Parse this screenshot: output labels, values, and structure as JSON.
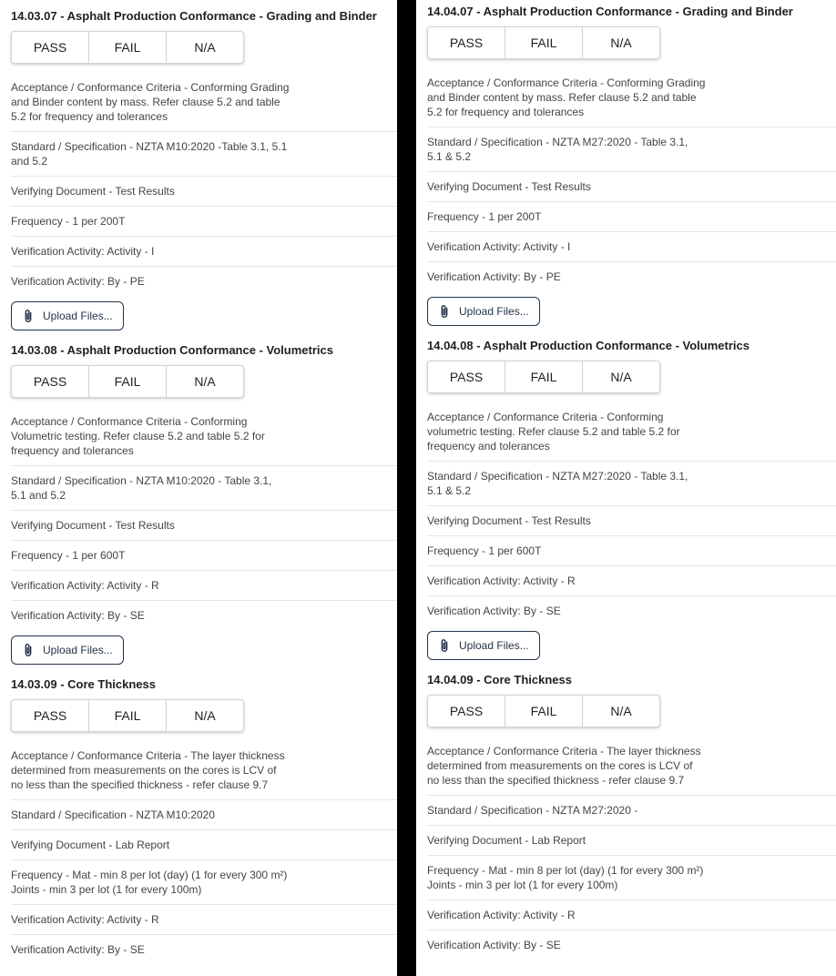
{
  "options": {
    "pass": "PASS",
    "fail": "FAIL",
    "na": "N/A"
  },
  "upload_label": "Upload Files...",
  "left": {
    "items": [
      {
        "title": "14.03.07 - Asphalt Production Conformance - Grading and Binder",
        "rows": [
          "Acceptance / Conformance Criteria - Conforming Grading and Binder content by mass. Refer clause 5.2 and table 5.2 for frequency and tolerances",
          "Standard / Specification - NZTA M10:2020 -Table 3.1, 5.1 and 5.2",
          "Verifying Document - Test Results",
          "Frequency - 1 per 200T",
          "Verification Activity: Activity - I",
          "Verification Activity: By - PE"
        ]
      },
      {
        "title": "14.03.08 - Asphalt Production Conformance - Volumetrics",
        "rows": [
          "Acceptance / Conformance Criteria - Conforming Volumetric testing. Refer clause 5.2 and table 5.2 for frequency and tolerances",
          "Standard / Specification - NZTA M10:2020 - Table 3.1, 5.1 and 5.2",
          "Verifying Document - Test Results",
          "Frequency - 1 per 600T",
          "Verification Activity: Activity - R",
          "Verification Activity: By - SE"
        ]
      },
      {
        "title": "14.03.09 - Core Thickness",
        "rows": [
          "Acceptance / Conformance Criteria - The layer thickness determined from measurements on the cores is LCV of no less than the specified thickness - refer clause 9.7",
          "Standard / Specification - NZTA M10:2020",
          "Verifying Document - Lab Report",
          "Frequency - Mat - min 8 per lot (day) (1 for every 300 m²) Joints - min 3 per lot (1 for every 100m)",
          "Verification Activity: Activity - R",
          "Verification Activity: By - SE"
        ]
      }
    ]
  },
  "right": {
    "items": [
      {
        "title": "14.04.07 - Asphalt Production Conformance - Grading and Binder",
        "rows": [
          "Acceptance / Conformance Criteria - Conforming Grading and Binder content by mass. Refer clause 5.2 and table 5.2 for frequency and tolerances",
          "Standard / Specification - NZTA M27:2020 - Table 3.1, 5.1 & 5.2",
          "Verifying Document - Test Results",
          "Frequency - 1 per 200T",
          "Verification Activity: Activity - I",
          "Verification Activity: By - PE"
        ]
      },
      {
        "title": "14.04.08 - Asphalt Production Conformance - Volumetrics",
        "rows": [
          "Acceptance / Conformance Criteria - Conforming volumetric testing. Refer clause 5.2 and table 5.2 for frequency and tolerances",
          "Standard / Specification - NZTA M27:2020 - Table 3.1, 5.1 & 5.2",
          "Verifying Document - Test Results",
          "Frequency - 1 per 600T",
          "Verification Activity: Activity - R",
          "Verification Activity: By - SE"
        ]
      },
      {
        "title": "14.04.09 - Core Thickness",
        "rows": [
          "Acceptance / Conformance Criteria - The layer thickness determined from measurements on the cores is LCV of no less than the specified thickness - refer clause 9.7",
          "Standard / Specification - NZTA M27:2020 -",
          "Verifying Document - Lab Report",
          "Frequency - Mat - min 8 per lot (day) (1 for every 300 m²) Joints - min 3 per lot (1 for every 100m)",
          "Verification Activity: Activity - R",
          "Verification Activity: By - SE"
        ]
      }
    ]
  }
}
